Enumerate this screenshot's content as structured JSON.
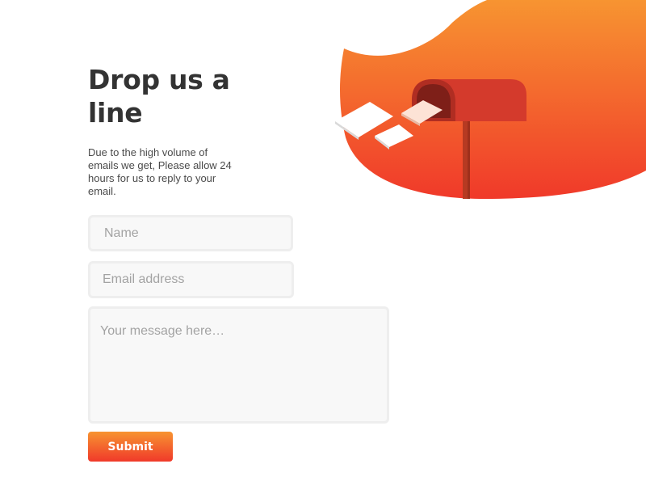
{
  "contact": {
    "title": "Drop us a line",
    "subtitle": "Due to the high volume of emails we get, Please allow 24 hours for us to reply to your email.",
    "name_placeholder": "Name",
    "email_placeholder": "Email address",
    "message_placeholder": "Your message here…",
    "submit_label": "Submit"
  },
  "illustration": {
    "icon": "mailbox-icon",
    "colors": {
      "gradient_top": "#f79431",
      "gradient_bottom": "#f0392a",
      "mailbox": "#d43a2c"
    }
  }
}
